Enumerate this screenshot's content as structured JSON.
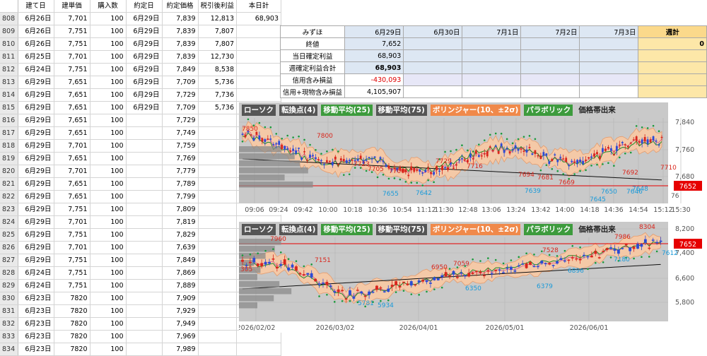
{
  "headers": {
    "c1": "建て日",
    "c2": "建単価",
    "c3": "購入数",
    "c4": "約定日",
    "c5": "約定価格",
    "c6": "税引後利益",
    "c7": "本日計",
    "c7_value": "68,903"
  },
  "rows": [
    {
      "n": "808",
      "d1": "6月26日",
      "p": "7,701",
      "q": "100",
      "d2": "6月29日",
      "sp": "7,839",
      "pl": "12,813"
    },
    {
      "n": "809",
      "d1": "6月26日",
      "p": "7,751",
      "q": "100",
      "d2": "6月29日",
      "sp": "7,839",
      "pl": "7,807"
    },
    {
      "n": "810",
      "d1": "6月26日",
      "p": "7,751",
      "q": "100",
      "d2": "6月29日",
      "sp": "7,839",
      "pl": "7,807"
    },
    {
      "n": "811",
      "d1": "6月25日",
      "p": "7,701",
      "q": "100",
      "d2": "6月29日",
      "sp": "7,839",
      "pl": "12,730"
    },
    {
      "n": "812",
      "d1": "6月24日",
      "p": "7,751",
      "q": "100",
      "d2": "6月29日",
      "sp": "7,849",
      "pl": "8,538"
    },
    {
      "n": "813",
      "d1": "6月29日",
      "p": "7,651",
      "q": "100",
      "d2": "6月29日",
      "sp": "7,709",
      "pl": "5,736"
    },
    {
      "n": "814",
      "d1": "6月29日",
      "p": "7,651",
      "q": "100",
      "d2": "6月29日",
      "sp": "7,729",
      "pl": "7,736"
    },
    {
      "n": "815",
      "d1": "6月29日",
      "p": "7,651",
      "q": "100",
      "d2": "6月29日",
      "sp": "7,709",
      "pl": "5,736"
    },
    {
      "n": "816",
      "d1": "6月29日",
      "p": "7,651",
      "q": "100",
      "d2": "",
      "sp": "7,729",
      "pl": ""
    },
    {
      "n": "817",
      "d1": "6月29日",
      "p": "7,651",
      "q": "100",
      "d2": "",
      "sp": "7,749",
      "pl": ""
    },
    {
      "n": "818",
      "d1": "6月29日",
      "p": "7,701",
      "q": "100",
      "d2": "",
      "sp": "7,759",
      "pl": ""
    },
    {
      "n": "819",
      "d1": "6月29日",
      "p": "7,651",
      "q": "100",
      "d2": "",
      "sp": "7,769",
      "pl": ""
    },
    {
      "n": "820",
      "d1": "6月29日",
      "p": "7,701",
      "q": "100",
      "d2": "",
      "sp": "7,779",
      "pl": ""
    },
    {
      "n": "821",
      "d1": "6月29日",
      "p": "7,651",
      "q": "100",
      "d2": "",
      "sp": "7,789",
      "pl": ""
    },
    {
      "n": "822",
      "d1": "6月29日",
      "p": "7,651",
      "q": "100",
      "d2": "",
      "sp": "7,799",
      "pl": ""
    },
    {
      "n": "823",
      "d1": "6月29日",
      "p": "7,751",
      "q": "100",
      "d2": "",
      "sp": "7,809",
      "pl": ""
    },
    {
      "n": "824",
      "d1": "6月29日",
      "p": "7,701",
      "q": "100",
      "d2": "",
      "sp": "7,819",
      "pl": ""
    },
    {
      "n": "825",
      "d1": "6月29日",
      "p": "7,751",
      "q": "100",
      "d2": "",
      "sp": "7,829",
      "pl": ""
    },
    {
      "n": "826",
      "d1": "6月29日",
      "p": "7,701",
      "q": "100",
      "d2": "",
      "sp": "7,639",
      "pl": ""
    },
    {
      "n": "827",
      "d1": "6月29日",
      "p": "7,751",
      "q": "100",
      "d2": "",
      "sp": "7,849",
      "pl": ""
    },
    {
      "n": "828",
      "d1": "6月24日",
      "p": "7,751",
      "q": "100",
      "d2": "",
      "sp": "7,869",
      "pl": ""
    },
    {
      "n": "829",
      "d1": "6月24日",
      "p": "7,751",
      "q": "100",
      "d2": "",
      "sp": "7,889",
      "pl": ""
    },
    {
      "n": "830",
      "d1": "6月23日",
      "p": "7820",
      "q": "100",
      "d2": "",
      "sp": "7,909",
      "pl": ""
    },
    {
      "n": "831",
      "d1": "6月23日",
      "p": "7820",
      "q": "100",
      "d2": "",
      "sp": "7,929",
      "pl": ""
    },
    {
      "n": "832",
      "d1": "6月23日",
      "p": "7820",
      "q": "100",
      "d2": "",
      "sp": "7,949",
      "pl": ""
    },
    {
      "n": "833",
      "d1": "6月23日",
      "p": "7820",
      "q": "100",
      "d2": "",
      "sp": "7,969",
      "pl": ""
    },
    {
      "n": "834",
      "d1": "6月23日",
      "p": "7820",
      "q": "100",
      "d2": "",
      "sp": "7,989",
      "pl": ""
    }
  ],
  "summary": {
    "header": {
      "label": "みずほ",
      "days": [
        "6月29日",
        "6月30日",
        "7月1日",
        "7月2日",
        "7月3日"
      ],
      "week": "週計"
    },
    "rows": [
      {
        "label": "終値",
        "v": "7,652",
        "week": "0"
      },
      {
        "label": "当日確定利益",
        "v": "68,903",
        "week": ""
      },
      {
        "label": "週確定利益合計",
        "v": "68,903",
        "week": ""
      },
      {
        "label": "信用含み損益",
        "v": "-430,093",
        "week": ""
      },
      {
        "label": "信用+現物含み損益",
        "v": "4,105,907",
        "week": ""
      }
    ]
  },
  "colors": {
    "up": "#d9261c",
    "down": "#2b4bd6",
    "band": "#f7c9a6",
    "ma25": "#1f8a2b",
    "ma75": "#111111",
    "sar": "#1a9a3a",
    "current_price": "#e60000"
  },
  "intraday": {
    "toolbar": [
      "ローソク",
      "転換点(4)",
      "移動平均(25)",
      "移動平均(75)",
      "ボリンジャー(10、±2σ)",
      "パラボリック",
      "価格帯出来"
    ],
    "xlabels": [
      "09:06",
      "09:24",
      "09:42",
      "10:00",
      "10:18",
      "10:36",
      "10:54",
      "11:12",
      "11:30",
      "12:48",
      "13:06",
      "13:24",
      "13:42",
      "14:00",
      "14:18",
      "14:36",
      "14:54",
      "15:12",
      "15:30"
    ],
    "ylabels": [
      "7,840",
      "7,760",
      "7,680"
    ],
    "current_price": "7652",
    "annotations": [
      "7850",
      "7800",
      "7723",
      "7705",
      "7700",
      "7729",
      "7716",
      "7694",
      "7681",
      "7669",
      "7692",
      "7710",
      "7655",
      "7642",
      "7639",
      "7645",
      "7650",
      "7646",
      "7648",
      "76"
    ]
  },
  "daily": {
    "toolbar": [
      "ローソク",
      "転換点(4)",
      "移動平均(25)",
      "移動平均(75)",
      "ボリンジャー(10、±2σ)",
      "パラボリック",
      "価格帯出来"
    ],
    "xlabels": [
      "2026/02/02",
      "2026/03/02",
      "2026/04/01",
      "2026/05/01",
      "2026/06/01"
    ],
    "ylabels": [
      "8,200",
      "7,400",
      "6,600",
      "5,800"
    ],
    "current_price": "7652",
    "annotations": [
      "7960",
      "7151",
      "6950",
      "7059",
      "7528",
      "7986",
      "8304",
      "6350",
      "6379",
      "6896",
      "5934",
      "5781",
      "7180",
      "7612",
      "305"
    ]
  }
}
